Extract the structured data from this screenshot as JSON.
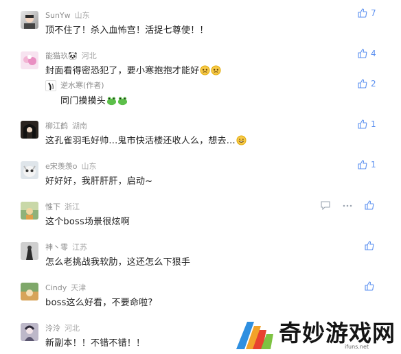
{
  "colors": {
    "accent": "#5a8ff0",
    "text": "#222222",
    "meta": "#9aa0a6"
  },
  "comments": [
    {
      "username": "SunYw",
      "region": "山东",
      "text": "顶不住了！杀入血怖宫！活捉七尊使！！",
      "likes": "7"
    },
    {
      "username": "能猫玖🐼",
      "region": "河北",
      "text": "封面看得密恐犯了，要小寒抱抱才能好",
      "emoji": "worried-face-emoji",
      "likes": "4"
    },
    {
      "username": "逆水寒(作者)",
      "region": "",
      "text": "同门摸摸头",
      "emoji": "frog-emoji",
      "likes": "2"
    },
    {
      "username": "柳江鹤",
      "region": "湖南",
      "text": "这孔雀羽毛好帅...鬼市快活楼还收人么，想去...",
      "emoji": "grin-emoji",
      "likes": "1"
    },
    {
      "username": "e宋羡羡o",
      "region": "山东",
      "text": "好好好，我肝肝肝，启动~",
      "likes": "1"
    },
    {
      "username": "惟下",
      "region": "浙江",
      "text": "这个boss场景很炫啊",
      "likes": ""
    },
    {
      "username": "神丶零",
      "region": "江苏",
      "text": "怎么老挑战我软肋，这还怎么下狠手",
      "likes": ""
    },
    {
      "username": "Cindy",
      "region": "天津",
      "text": "boss这么好看，不要命啦?",
      "likes": ""
    },
    {
      "username": "泠泠",
      "region": "河北",
      "text": "新副本！！不错不错！！",
      "likes": ""
    }
  ],
  "watermark": {
    "title": "奇妙游戏网",
    "url": "ifuns.net"
  },
  "icons": {
    "like": "thumbs-up-icon",
    "reply": "comment-bubble-icon",
    "more": "more-dots-icon"
  }
}
